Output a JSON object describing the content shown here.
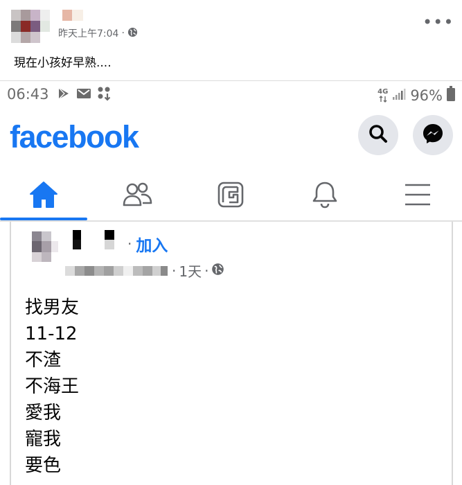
{
  "outer_post": {
    "time": "昨天上午7:04",
    "separator": "·",
    "privacy_icon": "globe-icon",
    "more_icon": "ellipsis-icon",
    "more_label": "•••",
    "text": "現在小孩好早熟...."
  },
  "status_bar": {
    "time": "06:43",
    "network": "4G",
    "battery": "96%",
    "icons": [
      "play-store-icon",
      "gmail-icon",
      "apps-download-icon",
      "signal-icon",
      "battery-icon"
    ]
  },
  "header": {
    "logo": "facebook",
    "search_icon": "search-icon",
    "messenger_icon": "messenger-icon",
    "brand_color": "#1877f2"
  },
  "nav": {
    "items": [
      {
        "name": "home",
        "icon": "home-icon",
        "active": true
      },
      {
        "name": "friends",
        "icon": "friends-icon",
        "active": false
      },
      {
        "name": "watch",
        "icon": "watch-icon",
        "active": false
      },
      {
        "name": "notifications",
        "icon": "bell-icon",
        "active": false
      },
      {
        "name": "menu",
        "icon": "hamburger-icon",
        "active": false
      }
    ]
  },
  "inner_post": {
    "separator": "·",
    "join_label": "加入",
    "time": "1天",
    "privacy_icon": "globe-icon",
    "lines": [
      "找男友",
      "11-12",
      "不渣",
      "不海王",
      "愛我",
      "寵我",
      "要色"
    ]
  }
}
